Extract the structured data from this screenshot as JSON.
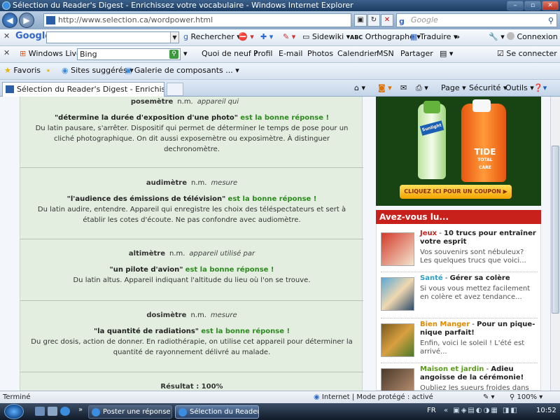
{
  "window": {
    "title": "Sélection du Reader's Digest - Enrichissez votre vocabulaire - Windows Internet Explorer"
  },
  "address": {
    "url": "http://www.selection.ca/wordpower.html",
    "search_placeholder": "Google"
  },
  "google_toolbar": {
    "logo": "Google",
    "items": [
      "Rechercher",
      "Sidewiki",
      "Orthographe",
      "Traduire",
      "»",
      "Connexion"
    ]
  },
  "live_toolbar": {
    "brand": "Windows Live",
    "search_value": "Bing",
    "items": [
      "Quoi de neuf ?",
      "Profil",
      "E-mail",
      "Photos",
      "Calendrier",
      "MSN",
      "Partager",
      "Se connecter"
    ]
  },
  "favorites_bar": {
    "favoris": "Favoris",
    "items": [
      "Sites suggérés",
      "Galerie de composants ..."
    ]
  },
  "tab": {
    "title": "Sélection du Reader's Digest - Enrichissez votre v..."
  },
  "commands": {
    "page": "Page",
    "securite": "Sécurité",
    "outils": "Outils"
  },
  "quiz": {
    "entries": [
      {
        "word": "posemètre",
        "pos": "n.m.",
        "category": "appareil qui",
        "quote": "\"détermine la durée d'exposition d'une photo\"",
        "answer": "est la bonne réponse !",
        "def1": "Du latin pausare, s'arrêter. Dispositif qui permet de déterminer le temps de pose pour un",
        "def2": "cliché photographique. On dit aussi exposemètre ou exposimètre. À distinguer",
        "def3": "dechronomètre."
      },
      {
        "word": "audimètre",
        "pos": "n.m.",
        "category": "mesure",
        "quote": "\"l'audience des émissions de télévision\"",
        "answer": "est la bonne réponse !",
        "def1": "Du latin audire, entendre. Appareil qui enregistre les choix des téléspectateurs et sert à",
        "def2": "établir les cotes d'écoute. Ne pas confondre avec audiomètre."
      },
      {
        "word": "altimètre",
        "pos": "n.m.",
        "category": "appareil utilisé par",
        "quote": "\"un pilote d'avion\"",
        "answer": "est la bonne réponse !",
        "def1": "Du latin altus. Appareil indiquant l'altitude du lieu où l'on se trouve."
      },
      {
        "word": "dosimètre",
        "pos": "n.m.",
        "category": "mesure",
        "quote": "\"la quantité de radiations\"",
        "answer": "est la bonne réponse !",
        "def1": "Du grec dosis, action de donner. En radiothérapie, on utilise cet appareil pour déterminer la",
        "def2": "quantité de rayonnement délivré au malade."
      }
    ],
    "result": "Résultat : 100%"
  },
  "ad": {
    "brand1": "Sunlight",
    "brand2": "TIDE",
    "brand2_sub": "TOTAL CARE",
    "coupon": "CLIQUEZ ICI POUR UN COUPON ▶"
  },
  "sidebar": {
    "heading": "Avez-vous lu...",
    "items": [
      {
        "category": "Jeux",
        "color": "#c8211b",
        "title": "10 trucs pour entraîner votre esprit",
        "desc": "Vos souvenirs sont nébuleux? Les quelques trucs que voici..."
      },
      {
        "category": "Santé",
        "color": "#2aa0c8",
        "title": "Gérer sa colère",
        "desc": "Si vous vous mettez facilement en colère et avez tendance..."
      },
      {
        "category": "Bien Manger",
        "color": "#e08a00",
        "title": "Pour un pique-nique parfait!",
        "desc": "Enfin, voici le soleil ! L'été est arrivé..."
      },
      {
        "category": "Maison et jardin",
        "color": "#5a9a1a",
        "title": "Adieu angoisse de la cérémonie!",
        "desc": "Oubliez les sueurs froides dans le..."
      }
    ]
  },
  "status": {
    "text": "Terminé",
    "zone": "Internet | Mode protégé : activé",
    "zoom": "100%"
  },
  "taskbar": {
    "buttons": [
      "Poster une réponse ...",
      "Sélection du Reader'..."
    ],
    "lang": "FR",
    "clock": "10:52"
  }
}
